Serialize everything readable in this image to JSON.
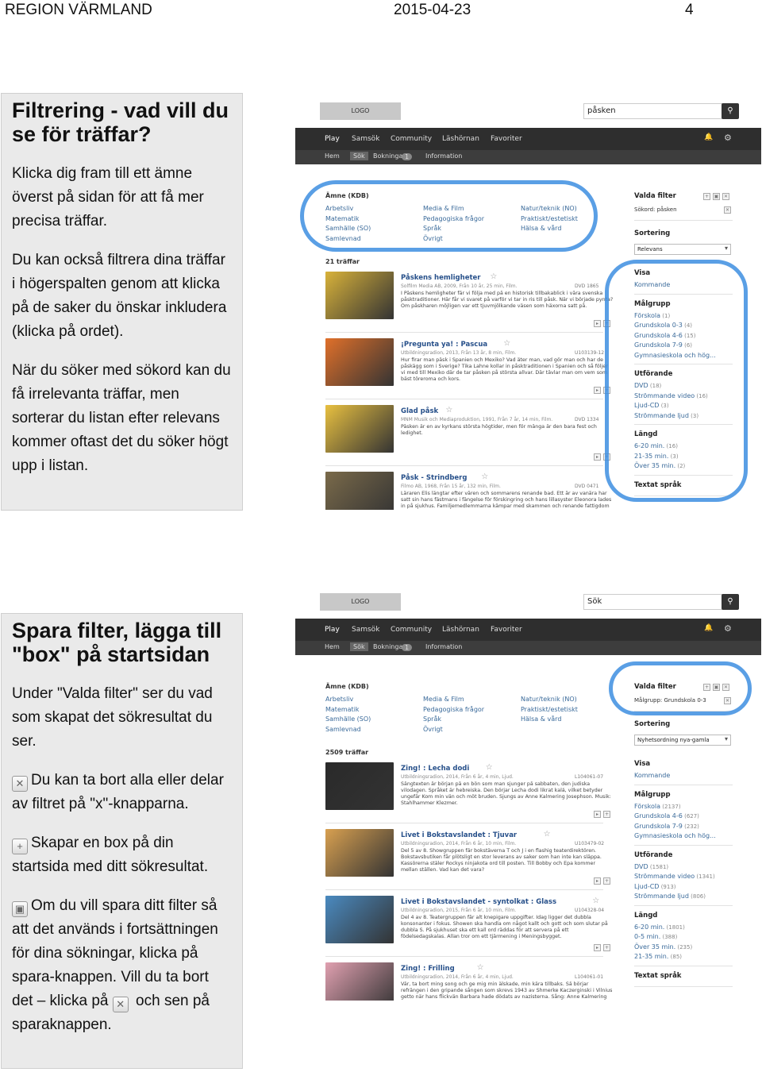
{
  "header": {
    "org": "REGION VÄRMLAND",
    "date": "2015-04-23",
    "page": "4"
  },
  "section1": {
    "title": "Filtrering - vad vill du se för träffar?",
    "p1": "Klicka dig fram till ett ämne överst på sidan för att få mer precisa träffar.",
    "p2": "Du kan också filtrera dina träffar i högerspalten genom att klicka på de saker du önskar inkludera (klicka på ordet).",
    "p3": "När du söker med sökord kan du få irrelevanta träffar, men sorterar du listan efter relevans kommer oftast det du söker högt upp i listan."
  },
  "section2": {
    "title": "Spara filter, lägga till \"box\" på startsidan",
    "p1": "Under \"Valda filter\" ser du vad som skapat det sökresultat du ser.",
    "p2": "Du kan ta bort alla eller delar av filtret på \"x\"-knapparna.",
    "p3": "Skapar en box på din startsida med ditt sökresultat.",
    "p4a": "Om du vill spara ditt filter så att det används i fortsättningen för dina sökningar, klicka på spara-knappen. Vill du ta bort det – klicka på",
    "p4b": "och sen på sparaknappen."
  },
  "screens": [
    {
      "logo": "LOGO",
      "search": "påsken",
      "nav": [
        "Play",
        "Samsök",
        "Community",
        "Läshörnan",
        "Favoriter"
      ],
      "subnav": [
        "Hem",
        "Sök",
        "Bokningar",
        "Information"
      ],
      "bookings": "1",
      "subject_head": "Ämne (KDB)",
      "subjects": [
        "Arbetsliv",
        "Matematik",
        "Samhälle (SO)",
        "Samlevnad",
        "Media & Film",
        "Pedagogiska frågor",
        "Språk",
        "Övrigt",
        "Natur/teknik (NO)",
        "Praktiskt/estetiskt",
        "Hälsa & vård"
      ],
      "count": "21 träffar",
      "filter_head": "Valda filter",
      "filter_item": "Sökord: påsken",
      "sort_head": "Sortering",
      "sort_value": "Relevans",
      "results": [
        {
          "title": "Påskens hemligheter",
          "meta": "Solfilm Media AB, 2009, Från 10 år, 25 min, Film.",
          "code": "DVD 1865",
          "desc": "I Påskens hemligheter får vi följa med på en historisk tillbakablick i våra svenska påsktraditioner. Här får vi svaret på varför vi tar in ris till påsk. När vi började pynta? Om påskharen möjligen var ett tjuvmjölkande väsen som häxorna satt på."
        },
        {
          "title": "¡Pregunta ya! : Pascua",
          "meta": "Utbildningsradion, 2013, Från 13 år, 8 min, Film.",
          "code": "U103139-12",
          "desc": "Hur firar man påsk i Spanien och Mexiko? Vad äter man, vad gör man och har de påskägg som i Sverige? Tika Lahne kollar in påsktraditionen i Spanien och så följer vi med till Mexiko där de tar påsken på största allvar. Där tävlar man om vem som bäst töreroma och kors."
        },
        {
          "title": "Glad påsk",
          "meta": "MNM Musik och Mediaproduktion, 1991, Från 7 år, 14 min, Film.",
          "code": "DVD 1334",
          "desc": "Påsken är en av kyrkans största högtider, men för många är den bara fest och ledighet."
        },
        {
          "title": "Påsk - Strindberg",
          "meta": "Filmo AB, 1968, Från 15 år, 132 min, Film.",
          "code": "DVD 0471",
          "desc": "Läraren Elis längtar efter våren och sommarens renande bad. Ett år av vanära har satt sin hans fästmans i fängelse för förskingring och hans lillasyster Eleonora lades in på sjukhus. Familjemedlemmarna kämpar med skammen och renande fattigdom och under tycks ha fastnat i det förflutna."
        }
      ],
      "facets": [
        {
          "head": "Visa",
          "items": [
            {
              "label": "Kommande",
              "n": ""
            }
          ]
        },
        {
          "head": "Målgrupp",
          "items": [
            {
              "label": "Förskola",
              "n": "(1)"
            },
            {
              "label": "Grundskola 0-3",
              "n": "(4)"
            },
            {
              "label": "Grundskola 4-6",
              "n": "(15)"
            },
            {
              "label": "Grundskola 7-9",
              "n": "(6)"
            },
            {
              "label": "Gymnasieskola och hög...",
              "n": ""
            }
          ]
        },
        {
          "head": "Utförande",
          "items": [
            {
              "label": "DVD",
              "n": "(18)"
            },
            {
              "label": "Strömmande video",
              "n": "(16)"
            },
            {
              "label": "Ljud-CD",
              "n": "(3)"
            },
            {
              "label": "Strömmande ljud",
              "n": "(3)"
            }
          ]
        },
        {
          "head": "Längd",
          "items": [
            {
              "label": "6-20 min.",
              "n": "(16)"
            },
            {
              "label": "21-35 min.",
              "n": "(3)"
            },
            {
              "label": "Över 35 min.",
              "n": "(2)"
            }
          ]
        },
        {
          "head": "Textat språk",
          "items": []
        }
      ]
    },
    {
      "logo": "LOGO",
      "search": "Sök",
      "nav": [
        "Play",
        "Samsök",
        "Community",
        "Läshörnan",
        "Favoriter"
      ],
      "subnav": [
        "Hem",
        "Sök",
        "Bokningar",
        "Information"
      ],
      "bookings": "1",
      "subject_head": "Ämne (KDB)",
      "subjects": [
        "Arbetsliv",
        "Matematik",
        "Samhälle (SO)",
        "Samlevnad",
        "Media & Film",
        "Pedagogiska frågor",
        "Språk",
        "Övrigt",
        "Natur/teknik (NO)",
        "Praktiskt/estetiskt",
        "Hälsa & vård"
      ],
      "count": "2509 träffar",
      "filter_head": "Valda filter",
      "filter_item": "Målgrupp: Grundskola 0-3",
      "sort_head": "Sortering",
      "sort_value": "Nyhetsordning nya-gamla",
      "results": [
        {
          "title": "Zing! : Lecha dodi",
          "meta": "Utbildningsradion, 2014, Från 6 år, 4 min, Ljud.",
          "code": "L104061-07",
          "desc": "Sångtexten är början på en bön som man sjunger på sabbaten, den judiska vilodagen. Språket är hebreiska. Den börjar Lecha dodi likrat kalá, vilket betyder ungefär Kom min vän och möt bruden. Sjungs av Anne Kalmering Josephson. Musik: Stahlhammer Klezmer."
        },
        {
          "title": "Livet i Bokstavslandet : Tjuvar",
          "meta": "Utbildningsradion, 2014, Från 6 år, 10 min, Film.",
          "code": "U103479-02",
          "desc": "Del 5 av 8. Showgruppen får bokstäverna T och J i en flashig teaterdirektören. Bokstavsbutiken får plötsligt en stor leverans av saker som han inte kan släppa. Kassörerna stäler Rockys ninjakota ord till posten. Till Bobby och Epa kommer mellan ställen. Vad kan det vara?"
        },
        {
          "title": "Livet i Bokstavslandet - syntolkat : Glass",
          "meta": "Utbildningsradion, 2015, Från 6 år, 10 min, Film.",
          "code": "U104328-04",
          "desc": "Del 4 av 8. Teatergruppen får alt knepigare uppgifter. Idag ligger det dubbla konsonanter i fokus. Showen ska handla om något kallt och gott och som slutar på dubbla S. På sjukhuset ska ett kall ord räddas för att servera på ett födelsedagskalas. Allan tror om ett tjärmening i Meningsbygget."
        },
        {
          "title": "Zing! : Frilling",
          "meta": "Utbildningsradion, 2014, Från 6 år, 4 min, Ljud.",
          "code": "L104061-01",
          "desc": "Vår, ta bort ming song och ge mig min älskade, min kära tillbaks. Så börjar refrängen i den gripande sången som skrevs 1943 av Shmerke Kaczerginski i Vilnius getto när hans flickvän Barbara hade dödats av nazisterna. Sång: Anne Kalmering Josephson."
        }
      ],
      "facets": [
        {
          "head": "Visa",
          "items": [
            {
              "label": "Kommande",
              "n": ""
            }
          ]
        },
        {
          "head": "Målgrupp",
          "items": [
            {
              "label": "Förskola",
              "n": "(2137)"
            },
            {
              "label": "Grundskola 4-6",
              "n": "(627)"
            },
            {
              "label": "Grundskola 7-9",
              "n": "(232)"
            },
            {
              "label": "Gymnasieskola och hög...",
              "n": ""
            }
          ]
        },
        {
          "head": "Utförande",
          "items": [
            {
              "label": "DVD",
              "n": "(1581)"
            },
            {
              "label": "Strömmande video",
              "n": "(1341)"
            },
            {
              "label": "Ljud-CD",
              "n": "(913)"
            },
            {
              "label": "Strömmande ljud",
              "n": "(806)"
            }
          ]
        },
        {
          "head": "Längd",
          "items": [
            {
              "label": "6-20 min.",
              "n": "(1801)"
            },
            {
              "label": "0-5 min.",
              "n": "(388)"
            },
            {
              "label": "Över 35 min.",
              "n": "(235)"
            },
            {
              "label": "21-35 min.",
              "n": "(85)"
            }
          ]
        },
        {
          "head": "Textat språk",
          "items": []
        }
      ]
    }
  ]
}
